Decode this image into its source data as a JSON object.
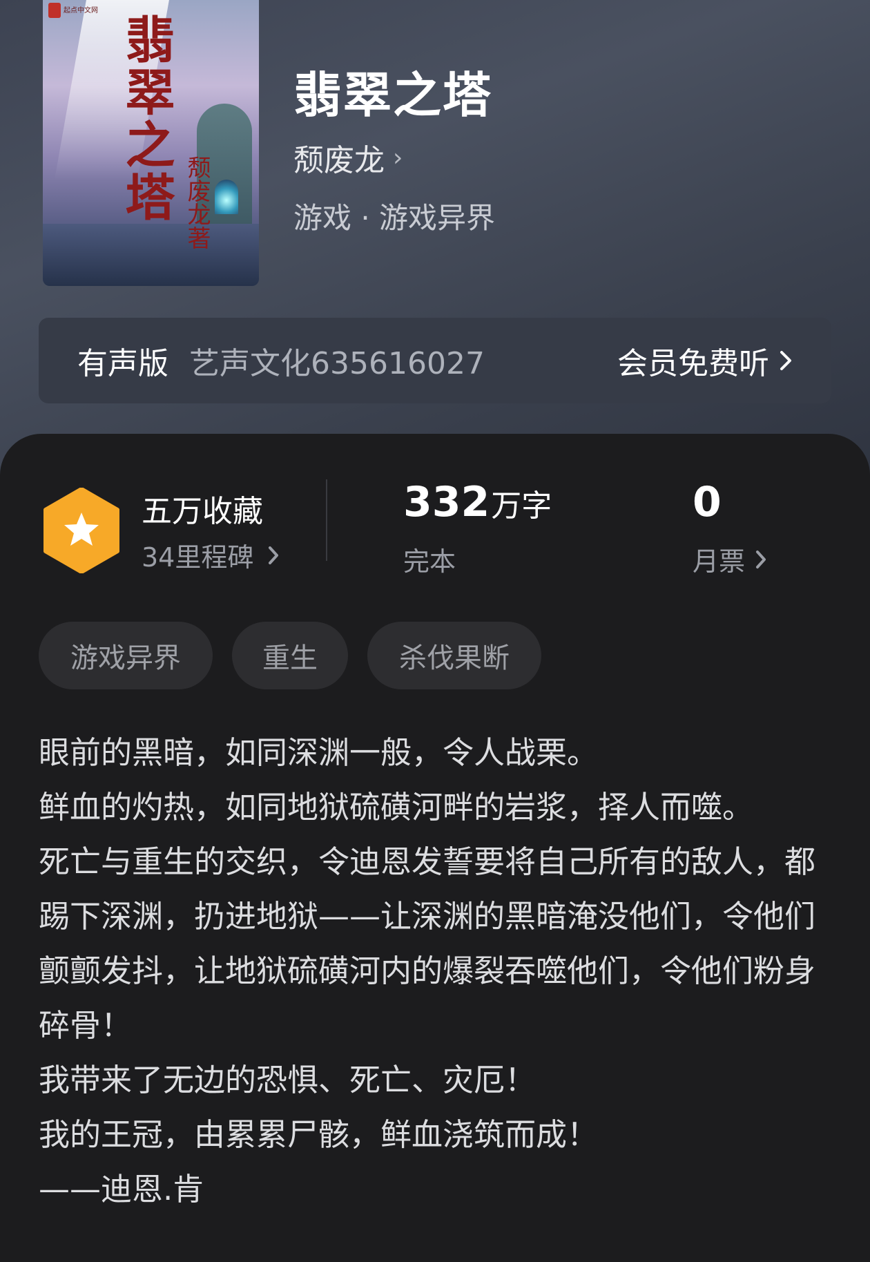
{
  "book": {
    "cover_title": "翡翠之塔",
    "cover_author": "颓废龙著",
    "cover_publisher": "起点中文网",
    "title": "翡翠之塔",
    "author": "颓废龙",
    "genre": "游戏 · 游戏异界"
  },
  "audio": {
    "label": "有声版",
    "narrator": "艺声文化635616027",
    "action": "会员免费听"
  },
  "stats": {
    "collect_title": "五万收藏",
    "collect_sub": "34里程碑",
    "word_count": "332",
    "word_unit": "万字",
    "status": "完本",
    "votes": "0",
    "votes_label": "月票"
  },
  "tags": [
    "游戏异界",
    "重生",
    "杀伐果断"
  ],
  "synopsis": [
    "眼前的黑暗，如同深渊一般，令人战栗。",
    "鲜血的灼热，如同地狱硫磺河畔的岩浆，择人而噬。",
    "死亡与重生的交织，令迪恩发誓要将自己所有的敌人，都踢下深渊，扔进地狱——让深渊的黑暗淹没他们，令他们颤颤发抖，让地狱硫磺河内的爆裂吞噬他们，令他们粉身碎骨！",
    "我带来了无边的恐惧、死亡、灾厄！",
    "我的王冠，由累累尸骸，鲜血浇筑而成！",
    "——迪恩.肯"
  ],
  "icons": {
    "collect": "star-hexagon-icon",
    "chevron": "chevron-right-icon"
  },
  "colors": {
    "accent_orange": "#f7a928",
    "background": "#1c1c1e",
    "header": "#434957"
  }
}
